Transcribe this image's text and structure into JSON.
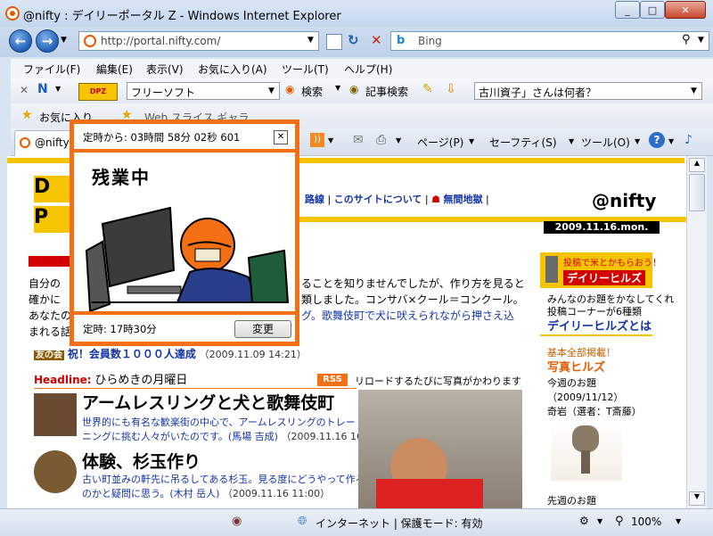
{
  "window": {
    "title": "@nifty : デイリーポータル Z - Windows Internet Explorer",
    "min": "_",
    "max": "□",
    "close": "✕"
  },
  "address": {
    "url": "http://portal.nifty.com/",
    "search_provider": "Bing"
  },
  "menu": [
    "ファイル(F)",
    "編集(E)",
    "表示(V)",
    "お気に入り(A)",
    "ツール(T)",
    "ヘルプ(H)"
  ],
  "toolbar": {
    "search_combo": "フリーソフト",
    "search_button": "検索",
    "article_search": "記事検索",
    "question": "古川資子」さんは何者？"
  },
  "favorites": {
    "label": "お気に入り",
    "webslice": "Web スライス ギャラ..."
  },
  "tab": {
    "label": "@nifty"
  },
  "commands": {
    "page": "ページ(P)",
    "safety": "セーフティ(S)",
    "tools": "ツール(O)"
  },
  "popup": {
    "header": "定時から: 03時間 58分 02秒 601",
    "handwriting": "残業中",
    "footer_label": "定時: 17時30分",
    "change_button": "変更"
  },
  "page": {
    "logo_text": "@nifty",
    "date": "2009.11.16.mon.",
    "nav_links": [
      "路線",
      "このサイトについて",
      "無間地獄"
    ],
    "intro_lines": [
      "自分の",
      "確かに",
      "あなたの",
      "まれる話"
    ],
    "intro_right_lines": [
      "ることを知りませんでしたが、作り方を見ると",
      "類しました。コンサバ×クール＝コンクール。",
      "グ。歌舞伎町で犬に吠えられながら押さえ込"
    ],
    "tomo_label": "友の会",
    "member_text": "祝！会員数１０００人達成",
    "member_date": "（2009.11.09 14:21）",
    "headline_label": "Headline:",
    "headline_title": "ひらめきの月曜日",
    "rss": "RSS",
    "reload_note": "リロードするたびに写真がかわります",
    "articles": [
      {
        "title": "アームレスリングと犬と歌舞伎町",
        "desc1": "世界的にも有名な歓楽街の中心で、アームレスリングのトレー",
        "desc2": "ニングに挑む人々がいたのです。(馬場 吉成)",
        "date": "（2009.11.16 16:00）"
      },
      {
        "title": "体験、杉玉作り",
        "desc1": "古い町並みの軒先に吊るしてある杉玉。見る度にどうやって作る",
        "desc2": "のかと疑問に思う。(木村 岳人)",
        "date": "（2009.11.16 11:00）"
      }
    ],
    "side": {
      "banner_top": "投稿で米とかもらおう！",
      "banner_name": "デイリーヒルズ",
      "desc1": "みんなのお題をかなしてくれ",
      "desc2": "投稿コーナーが6種類",
      "link": "デイリーヒルズとは",
      "recruit": "基本全部掲載！",
      "photo_title": "写真ヒルズ",
      "this_week": "今週のお題",
      "week_date": "（2009/11/12）",
      "rock": "奇岩（選者：T斎藤）",
      "last_week": "先週のお題"
    }
  },
  "status": {
    "zone": "インターネット | 保護モード: 有効",
    "zoom": "100%"
  },
  "colors": {
    "accent": "#f56f14",
    "yellow": "#f6c400"
  }
}
